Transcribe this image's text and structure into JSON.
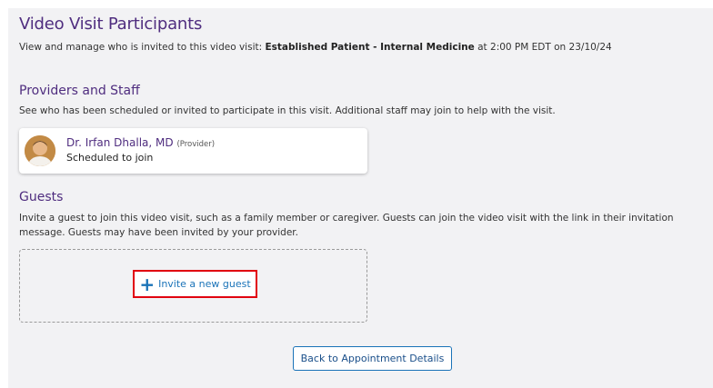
{
  "header": {
    "title": "Video Visit Participants",
    "desc_prefix": "View and manage who is invited to this video visit: ",
    "desc_visit": "Established Patient - Internal Medicine",
    "desc_suffix": " at 2:00 PM EDT on 23/10/24"
  },
  "providers": {
    "title": "Providers and Staff",
    "description": "See who has been scheduled or invited to participate in this visit. Additional staff may join to help with the visit.",
    "items": [
      {
        "name": "Dr. Irfan Dhalla, MD",
        "role": "(Provider)",
        "status": "Scheduled to join",
        "avatar_icon": "person-photo"
      }
    ]
  },
  "guests": {
    "title": "Guests",
    "description": "Invite a guest to join this video visit, such as a family member or caregiver. Guests can join the video visit with the link in their invitation message. Guests may have been invited by your provider.",
    "invite_label": "Invite a new guest",
    "invite_icon": "plus-icon"
  },
  "footer": {
    "back_label": "Back to Appointment Details"
  },
  "colors": {
    "heading": "#4f2d7f",
    "link": "#1a73b8",
    "highlight": "#e1000f",
    "panel_bg": "#f2f2f4"
  }
}
